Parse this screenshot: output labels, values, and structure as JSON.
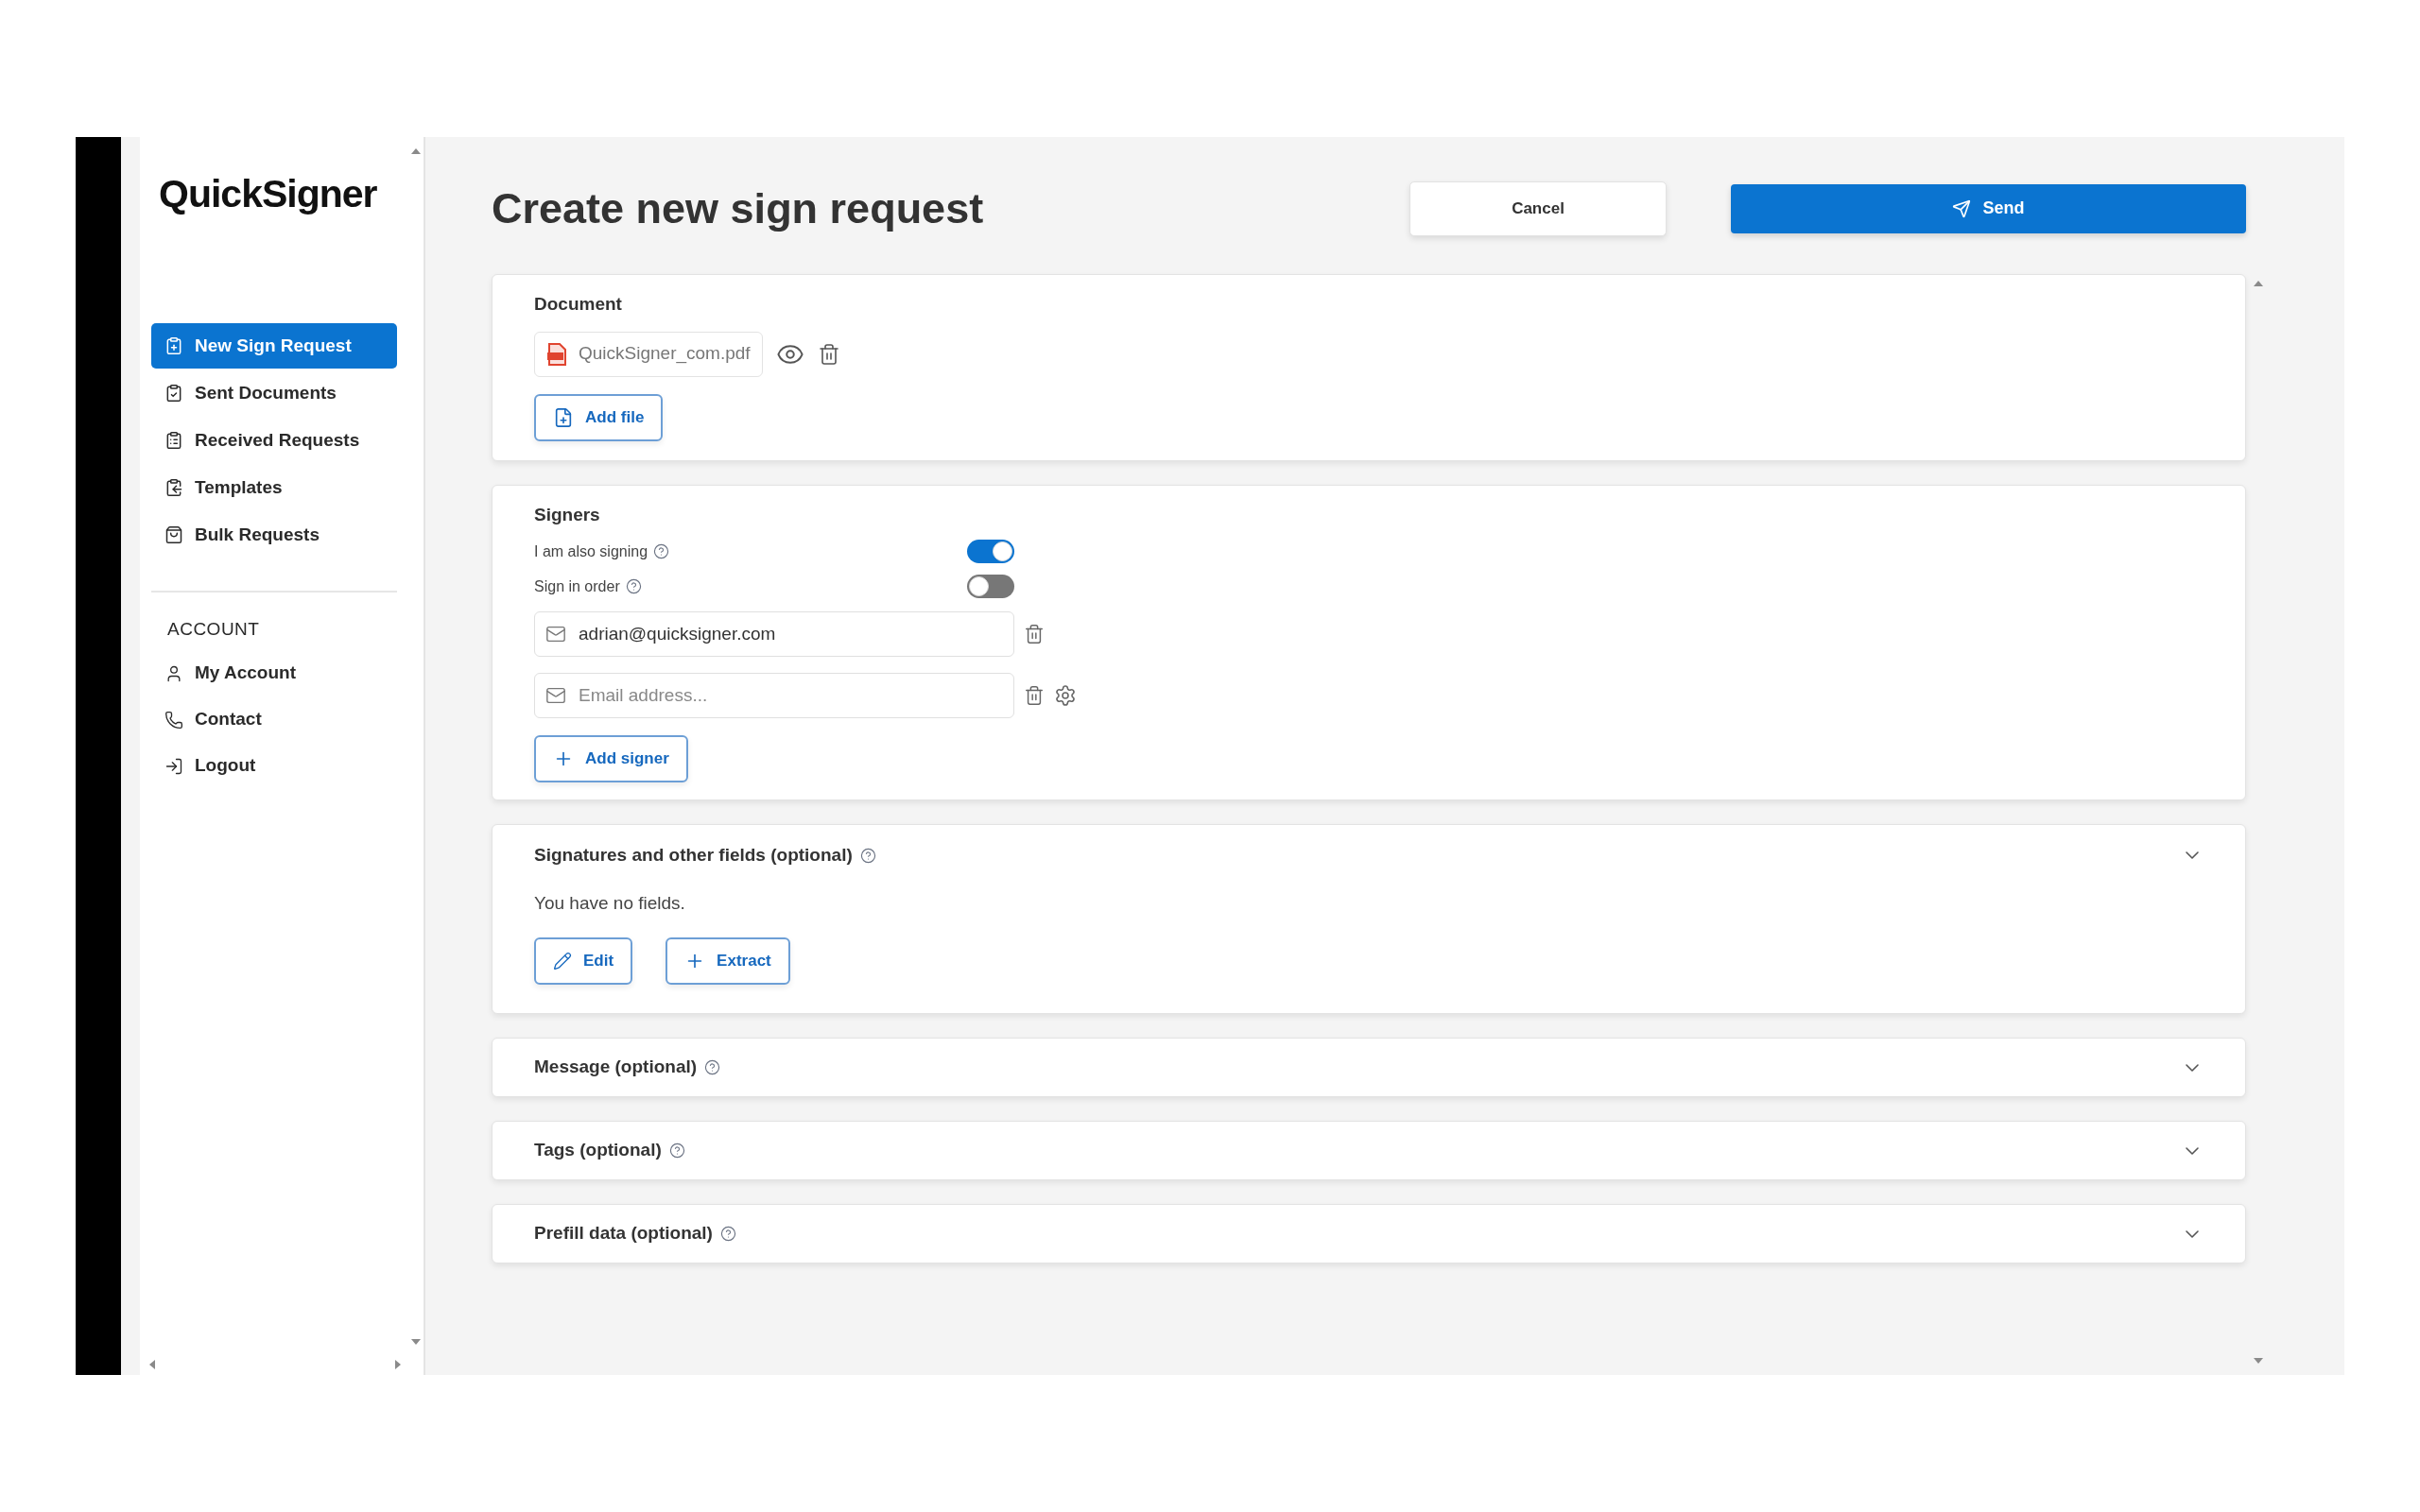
{
  "logo": "QuickSigner",
  "sidebar": {
    "items": [
      {
        "label": "New Sign Request",
        "selected": true
      },
      {
        "label": "Sent Documents",
        "selected": false
      },
      {
        "label": "Received Requests",
        "selected": false
      },
      {
        "label": "Templates",
        "selected": false
      },
      {
        "label": "Bulk Requests",
        "selected": false
      }
    ],
    "section_label": "ACCOUNT",
    "account_items": [
      {
        "label": "My Account"
      },
      {
        "label": "Contact"
      },
      {
        "label": "Logout"
      }
    ]
  },
  "header": {
    "title": "Create new sign request",
    "buttons": [
      {
        "label": "Cancel",
        "kind": "secondary"
      },
      {
        "label": "Send",
        "kind": "primary"
      }
    ]
  },
  "document": {
    "title": "Document",
    "file": "QuickSigner_com.pdf",
    "add_button": "Add file"
  },
  "signers": {
    "title": "Signers",
    "toggles": [
      {
        "label": "I am also signing",
        "on": true
      },
      {
        "label": "Sign in order",
        "on": false
      }
    ],
    "fields": [
      {
        "value": "adrian@quicksigner.com",
        "settings": false
      },
      {
        "placeholder": "Email address...",
        "settings": true
      }
    ],
    "add_button": "Add signer"
  },
  "fields_section": {
    "title": "Signatures and other fields (optional)",
    "empty_text": "You have no fields.",
    "buttons": [
      {
        "label": "Edit",
        "kind": "edit"
      },
      {
        "label": "Extract",
        "kind": "add"
      }
    ]
  },
  "collapsed_sections": [
    {
      "title": "Message (optional)"
    },
    {
      "title": "Tags (optional)"
    },
    {
      "title": "Prefill data (optional)"
    }
  ]
}
